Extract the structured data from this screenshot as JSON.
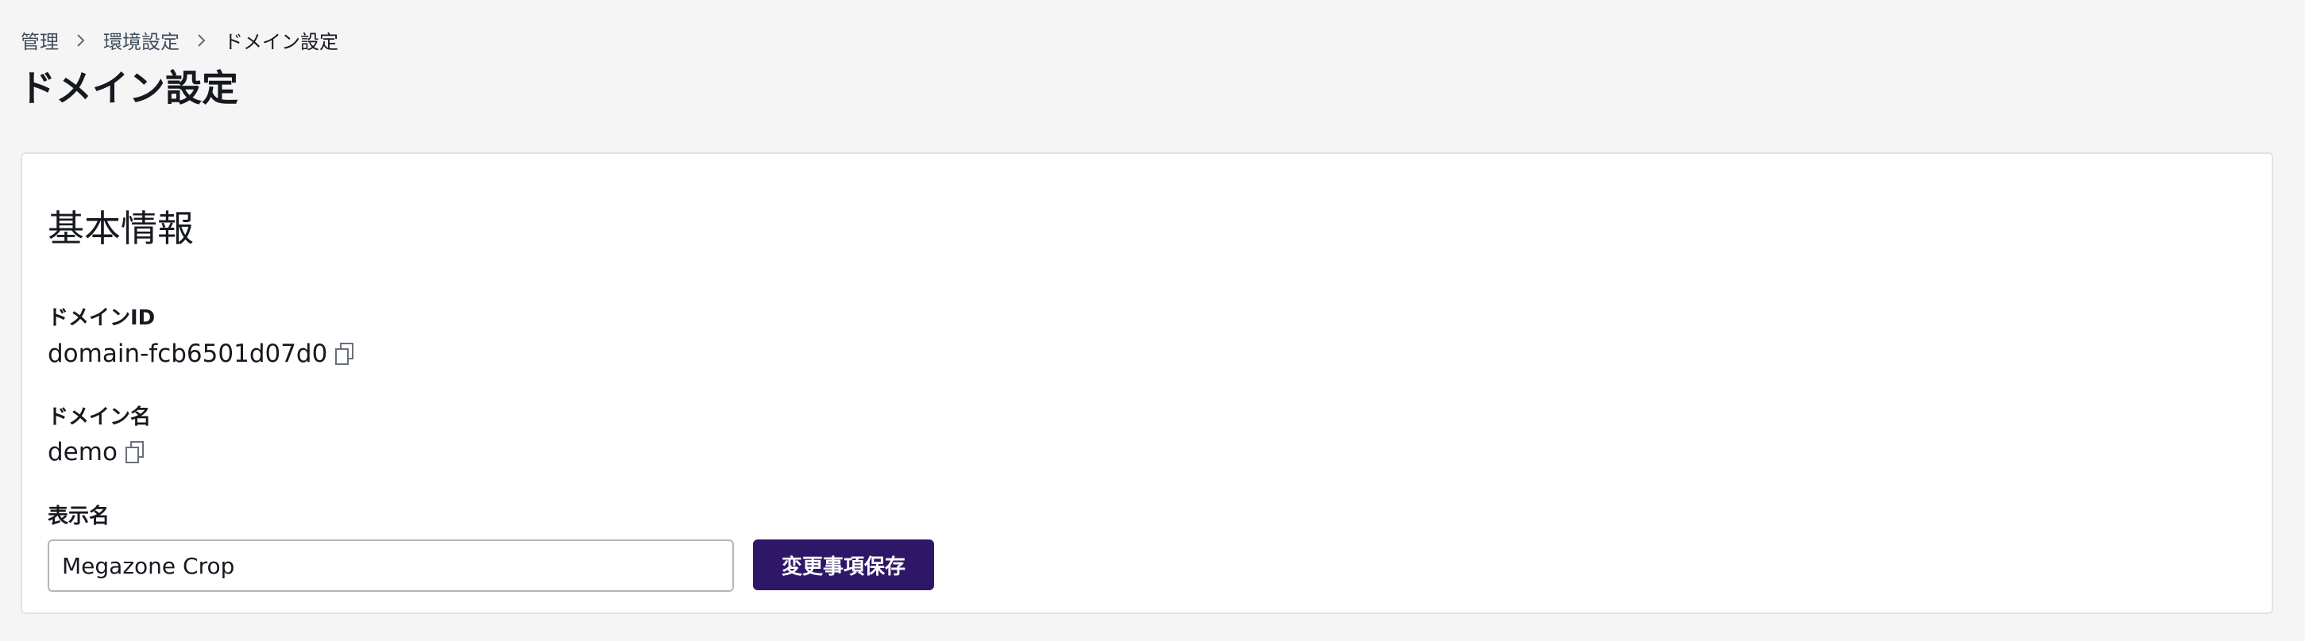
{
  "breadcrumb": {
    "items": [
      "管理",
      "環境設定",
      "ドメイン設定"
    ],
    "separator_icon": "chevron-right-icon"
  },
  "page": {
    "title": "ドメイン設定"
  },
  "panel": {
    "section_title": "基本情報",
    "domain_id": {
      "label": "ドメインID",
      "value": "domain-fcb6501d07d0",
      "icon": "copy-icon"
    },
    "domain_name": {
      "label": "ドメイン名",
      "value": "demo",
      "icon": "copy-icon"
    },
    "display_name": {
      "label": "表示名",
      "value": "Megazone Crop"
    },
    "save_button_label": "変更事項保存"
  },
  "colors": {
    "background": "#f5f5f6",
    "panel": "#ffffff",
    "panel_border": "#e2e3e6",
    "primary_button": "#2f1768",
    "text": "#16191f",
    "muted_text": "#414d5c"
  }
}
